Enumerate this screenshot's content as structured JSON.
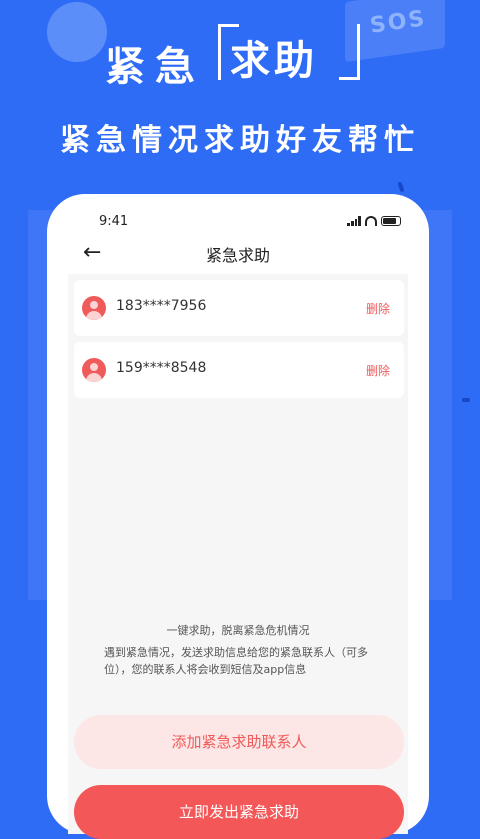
{
  "banner": {
    "title_part1": "紧急",
    "title_part2": "求助",
    "subtitle": "紧急情况求助好友帮忙",
    "sos_label": "SOS"
  },
  "status_bar": {
    "time": "9:41"
  },
  "nav": {
    "title": "紧急求助",
    "back_icon": "arrow-left-icon"
  },
  "contacts": [
    {
      "phone": "183****7956",
      "delete_label": "删除"
    },
    {
      "phone": "159****8548",
      "delete_label": "删除"
    }
  ],
  "hint": {
    "line1": "一键求助，脱离紧急危机情况",
    "line2": "遇到紧急情况，发送求助信息给您的紧急联系人（可多位），您的联系人将会收到短信及app信息"
  },
  "buttons": {
    "add_contact": "添加紧急求助联系人",
    "send_sos": "立即发出紧急求助"
  },
  "colors": {
    "background": "#2f6cf6",
    "accent_red": "#f35757",
    "light_red": "#fde6e6"
  }
}
